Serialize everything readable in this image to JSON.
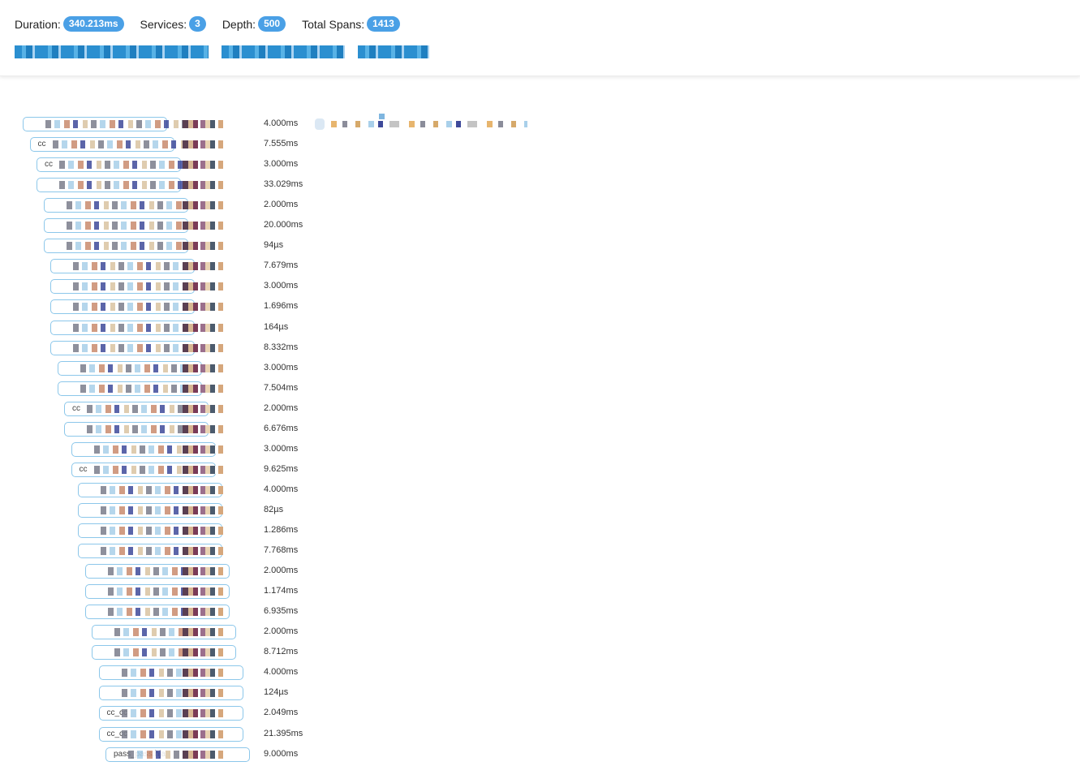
{
  "header": {
    "stats": [
      {
        "label": "Duration:",
        "value": "340.213ms"
      },
      {
        "label": "Services:",
        "value": "3"
      },
      {
        "label": "Depth:",
        "value": "500"
      },
      {
        "label": "Total Spans:",
        "value": "1413"
      }
    ]
  },
  "spans": [
    {
      "label": "",
      "duration": "4.000ms",
      "indent": 0
    },
    {
      "label": "cc",
      "duration": "7.555ms",
      "indent": 1
    },
    {
      "label": "cc",
      "duration": "3.000ms",
      "indent": 2
    },
    {
      "label": "",
      "duration": "33.029ms",
      "indent": 2
    },
    {
      "label": "",
      "duration": "2.000ms",
      "indent": 3
    },
    {
      "label": "",
      "duration": "20.000ms",
      "indent": 3
    },
    {
      "label": "",
      "duration": "94µs",
      "indent": 3
    },
    {
      "label": "",
      "duration": "7.679ms",
      "indent": 4
    },
    {
      "label": "",
      "duration": "3.000ms",
      "indent": 4
    },
    {
      "label": "",
      "duration": "1.696ms",
      "indent": 4
    },
    {
      "label": "",
      "duration": "164µs",
      "indent": 4
    },
    {
      "label": "",
      "duration": "8.332ms",
      "indent": 4
    },
    {
      "label": "",
      "duration": "3.000ms",
      "indent": 5
    },
    {
      "label": "",
      "duration": "7.504ms",
      "indent": 5
    },
    {
      "label": "cc",
      "duration": "2.000ms",
      "indent": 6
    },
    {
      "label": "",
      "duration": "6.676ms",
      "indent": 6
    },
    {
      "label": "",
      "duration": "3.000ms",
      "indent": 7
    },
    {
      "label": "cc",
      "duration": "9.625ms",
      "indent": 7
    },
    {
      "label": "",
      "duration": "4.000ms",
      "indent": 8
    },
    {
      "label": "",
      "duration": "82µs",
      "indent": 8
    },
    {
      "label": "",
      "duration": "1.286ms",
      "indent": 8
    },
    {
      "label": "",
      "duration": "7.768ms",
      "indent": 8
    },
    {
      "label": "",
      "duration": "2.000ms",
      "indent": 9
    },
    {
      "label": "",
      "duration": "1.174ms",
      "indent": 9
    },
    {
      "label": "",
      "duration": "6.935ms",
      "indent": 9
    },
    {
      "label": "",
      "duration": "2.000ms",
      "indent": 10
    },
    {
      "label": "",
      "duration": "8.712ms",
      "indent": 10
    },
    {
      "label": "",
      "duration": "4.000ms",
      "indent": 11
    },
    {
      "label": "",
      "duration": "124µs",
      "indent": 11
    },
    {
      "label": "cc_cc",
      "duration": "2.049ms",
      "indent": 11
    },
    {
      "label": "cc_cc",
      "duration": "21.395ms",
      "indent": 11
    },
    {
      "label": "pass_pass.hja",
      "duration": "9.000ms",
      "indent": 12
    }
  ]
}
